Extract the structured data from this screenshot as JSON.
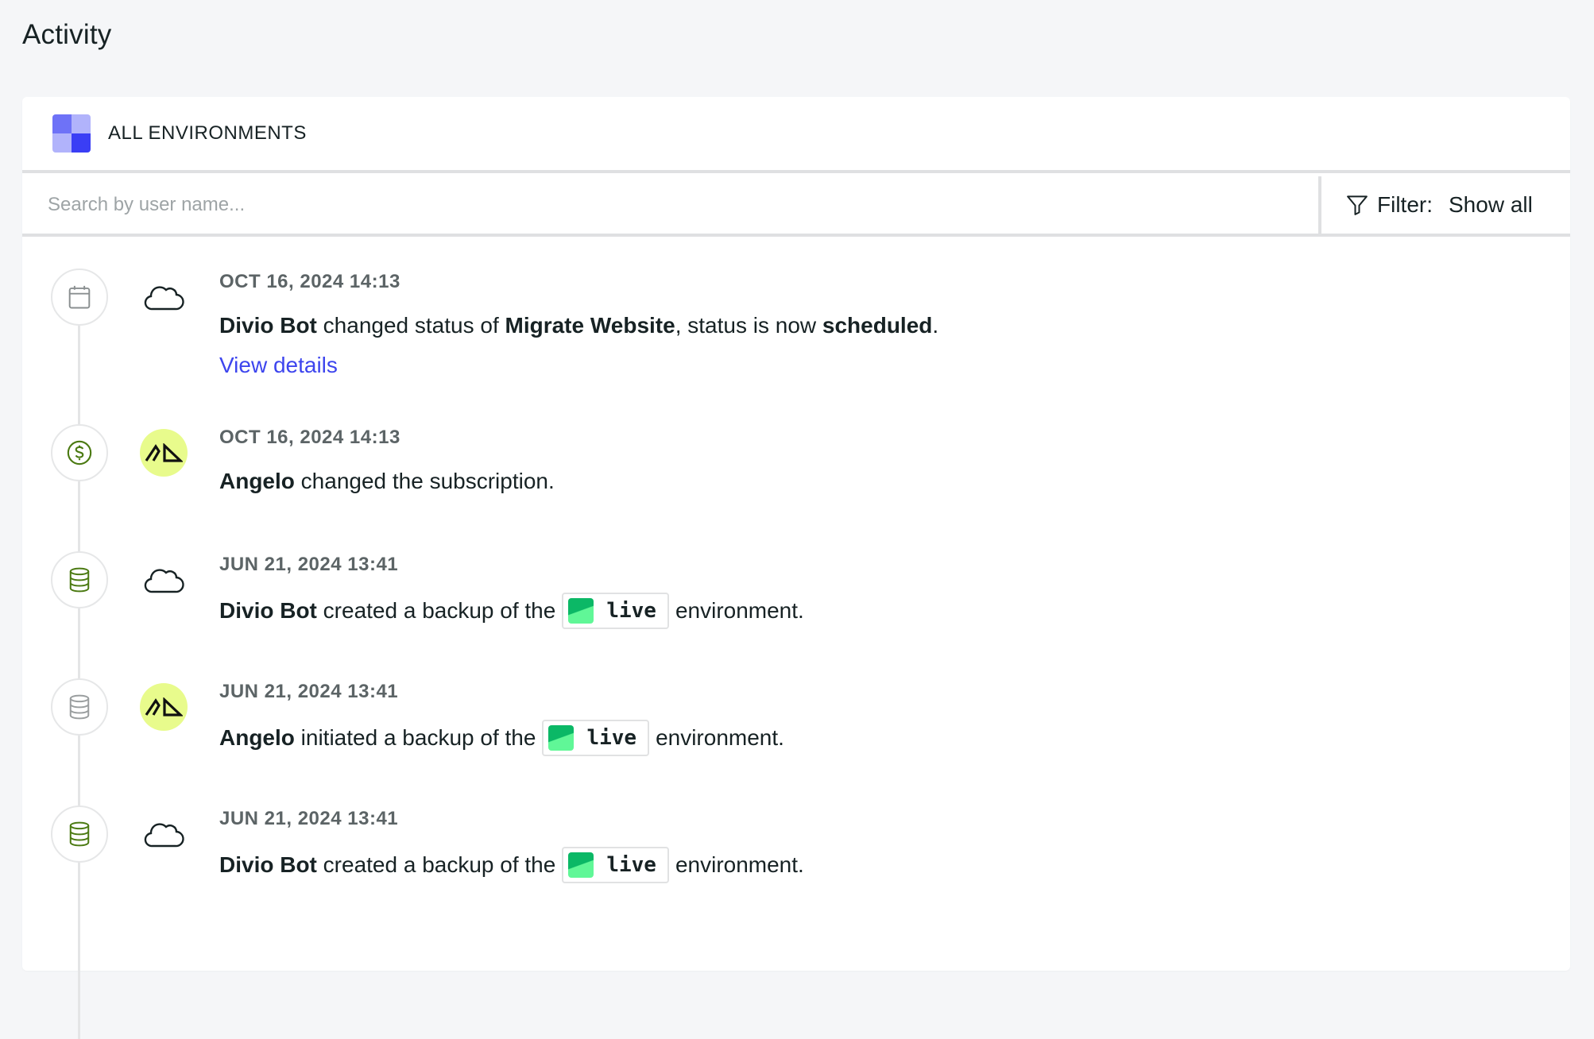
{
  "page": {
    "title": "Activity"
  },
  "header": {
    "environment_label": "ALL ENVIRONMENTS",
    "icon": "environments-grid-icon"
  },
  "search": {
    "placeholder": "Search by user name...",
    "value": ""
  },
  "filter": {
    "label": "Filter:",
    "value": "Show all",
    "icon": "filter-funnel-icon"
  },
  "colors": {
    "accent_link": "#3d45ee",
    "avatar_angelo_bg": "#e8fb8c",
    "success_green": "#4b7a12",
    "env_live_dark": "#0bb866",
    "env_live_light": "#60f797"
  },
  "activities": [
    {
      "type_icon": "calendar-icon",
      "actor_icon": "cloud-icon",
      "date": "OCT 16, 2024 14:13",
      "actor": "Divio Bot",
      "t1": " changed status of ",
      "object": "Migrate Website",
      "t2": ", status is now ",
      "status": "scheduled",
      "t3": ".",
      "link": "View details"
    },
    {
      "type_icon": "dollar-icon",
      "actor_icon": "angelo-avatar",
      "date": "OCT 16, 2024 14:13",
      "actor": "Angelo",
      "t1": " changed the subscription."
    },
    {
      "type_icon": "database-icon",
      "actor_icon": "cloud-icon",
      "date": "JUN 21, 2024 13:41",
      "actor": "Divio Bot",
      "t1": " created a backup of the",
      "environment": "live",
      "t2": "environment."
    },
    {
      "type_icon": "database-icon",
      "actor_icon": "angelo-avatar",
      "date": "JUN 21, 2024 13:41",
      "actor": "Angelo",
      "t1": " initiated a backup of the",
      "environment": "live",
      "t2": "environment."
    },
    {
      "type_icon": "database-icon",
      "actor_icon": "cloud-icon",
      "date": "JUN 21, 2024 13:41",
      "actor": "Divio Bot",
      "t1": " created a backup of the",
      "environment": "live",
      "t2": "environment."
    }
  ]
}
